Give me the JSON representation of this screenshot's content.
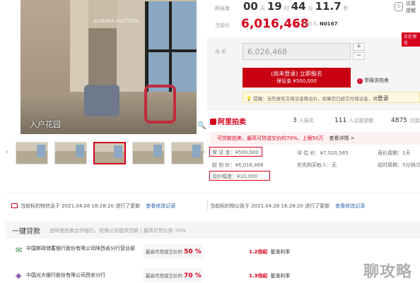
{
  "photo": {
    "caption": "入户花园",
    "watermark": "ALIBABA AUCTION"
  },
  "thumbnails": [
    {
      "id": "t1"
    },
    {
      "id": "t2"
    },
    {
      "id": "t3",
      "selected": true
    },
    {
      "id": "t4"
    },
    {
      "id": "t5"
    }
  ],
  "countdown": {
    "label": "距结束",
    "days": "00",
    "days_unit": "天",
    "hours": "19",
    "hours_unit": "时",
    "minutes": "44",
    "minutes_unit": "分",
    "seconds": "11.7",
    "seconds_unit": "秒"
  },
  "remind": {
    "line1": "设置",
    "line2": "提醒"
  },
  "current": {
    "label": "当前价",
    "price": "6,016,468",
    "unit": "元",
    "bid_label": "出价人",
    "bid_no": "N0167",
    "lead_tag": "正在领先"
  },
  "bid": {
    "label": "出 价",
    "value": "6,026,468",
    "stepper_up": "+",
    "stepper_down": "−",
    "button_line1": "(尚未登录) 立即报名",
    "button_line2": "保证金 ¥500,000",
    "report": "举报该拍卖"
  },
  "tip": {
    "prefix": "提醒：当先报名交保证金再出价，如果您已经交付保证金，请",
    "link": "登录"
  },
  "platform": {
    "logo": "阿里拍卖",
    "signups": "3",
    "signups_label": "人报名",
    "reminders": "111",
    "reminders_label": "人设置提醒",
    "views": "4875",
    "views_label": "次围观"
  },
  "promo": {
    "text": "可贷款拍卖，最高可贷成交价的70%，上限50万",
    "link": "查看详情 >"
  },
  "info": {
    "deposit_label": "保 证 金",
    "deposit": "¥500,000",
    "appraise_label": "评 估 价",
    "appraise": "¥7,520,585",
    "cycle_label": "竞价周期",
    "cycle": "1天",
    "start_label": "起 拍 价",
    "start": "¥6,016,468",
    "priority_label": "优先购买权人",
    "priority": "无",
    "delay_label": "延时周期",
    "delay": "5分钟/次",
    "increment_label": "加价幅度",
    "increment": "¥10,000"
  },
  "updates": {
    "left": "当前标的物信息于 2021.04.26 16:28:20 进行了更新",
    "left_link": "查看修改记录",
    "right": "当前标的物公告于 2021.04.26 16:28:20 进行了更新",
    "right_link": "查看修改记录"
  },
  "loan": {
    "title": "一键贷款",
    "subtitle": "由阿里拍卖合作银行，担保公司提供贷款 | 最高可贷比例 70%",
    "banks": [
      {
        "name": "中国邮政储蓄银行股份有限公司陕西省分行营业部",
        "rate_text": "最高可贷成交价的",
        "rate": "50 %",
        "float": "1.2倍起",
        "float_label": "基准利率"
      },
      {
        "name": "中国光大银行股份有限公司西安分行",
        "rate_text": "最高可贷成交价的",
        "rate": "70 %",
        "float": "1.3倍起",
        "float_label": "基准利率"
      }
    ]
  },
  "watermark": "聊攻略",
  "colors": {
    "accent": "#d6001c",
    "link": "#2a5fb0"
  }
}
